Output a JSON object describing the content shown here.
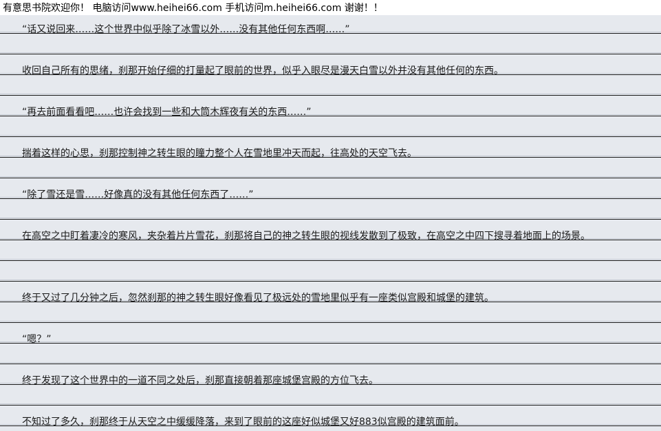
{
  "banner": "有意思书院欢迎你！ 电脑访问www.heihei66.com 手机访问m.heihei66.com 谢谢！！",
  "paragraphs": [
    "“话又说回来……这个世界中似乎除了冰雪以外……没有其他任何东西啊……”",
    "收回自己所有的思绪，刹那开始仔细的打量起了眼前的世界，似乎入眼尽是漫天白雪以外并没有其他任何的东西。",
    "“再去前面看看吧……也许会找到一些和大筒木辉夜有关的东西……”",
    "揣着这样的心思，刹那控制神之转生眼的瞳力整个人在雪地里冲天而起，往高处的天空飞去。",
    "“除了雪还是雪……好像真的没有其他任何东西了……”",
    "在高空之中盯着凄冷的寒风，夹杂着片片雪花，刹那将自己的神之转生眼的视线发散到了极致，在高空之中四下搜寻着地面上的场景。",
    "终于又过了几分钟之后，忽然刹那的神之转生眼好像看见了极远处的雪地里似乎有一座类似宫殿和城堡的建筑。",
    "“嗯？”",
    "终于发现了这个世界中的一道不同之处后，刹那直接朝着那座城堡宫殿的方位飞去。",
    "不知过了多久，刹那终于从天空之中缓缓降落，来到了眼前的这座好似城堡又好883似宫殿的建筑面前。"
  ]
}
